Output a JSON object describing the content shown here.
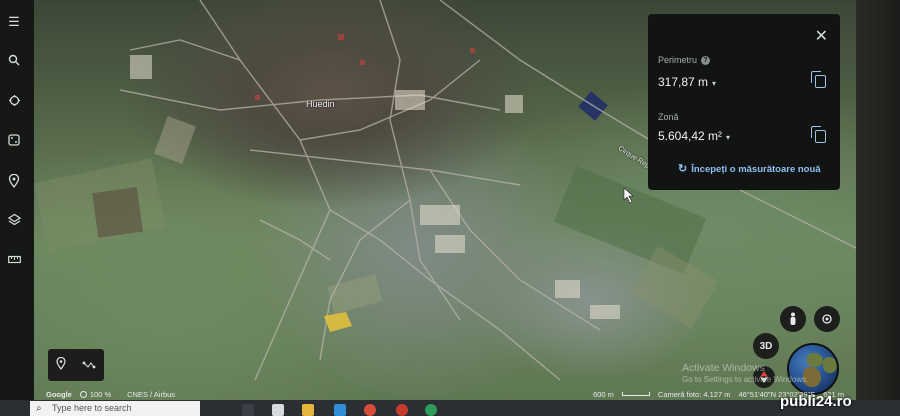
{
  "map": {
    "town_label": "Huedin",
    "road_label": "Cirque Rep"
  },
  "measure_panel": {
    "perimeter_label": "Perimetru",
    "perimeter_value": "317,87 m",
    "area_label": "Zonă",
    "area_value": "5.604,42 m²",
    "new_measure_label": "Începeți o măsurătoare nouă",
    "close": "✕"
  },
  "sidebar": {
    "icons": [
      "menu-icon",
      "search-icon",
      "voyager-icon",
      "dice-icon",
      "place-icon",
      "layers-icon",
      "ruler-icon"
    ]
  },
  "map_controls": {
    "view_3d_label": "3D"
  },
  "status_bar": {
    "google": "Google",
    "percent": "100 %",
    "attribution": "CNES / Airbus",
    "scale": "600 m",
    "camera": "Cameră foto: 4.127 m",
    "coordinates": "46°51'40\"N 23°02'39\"E",
    "elevation": "621 m"
  },
  "watermark": {
    "title": "Activate Windows",
    "subtitle": "Go to Settings to activate Windows."
  },
  "taskbar": {
    "search_placeholder": "Type here to search"
  },
  "logo": {
    "text": "publi24.ro"
  },
  "colors": {
    "accent": "#8ec0f2",
    "panel_bg": "#111413",
    "polygon": "#e8c23a"
  }
}
